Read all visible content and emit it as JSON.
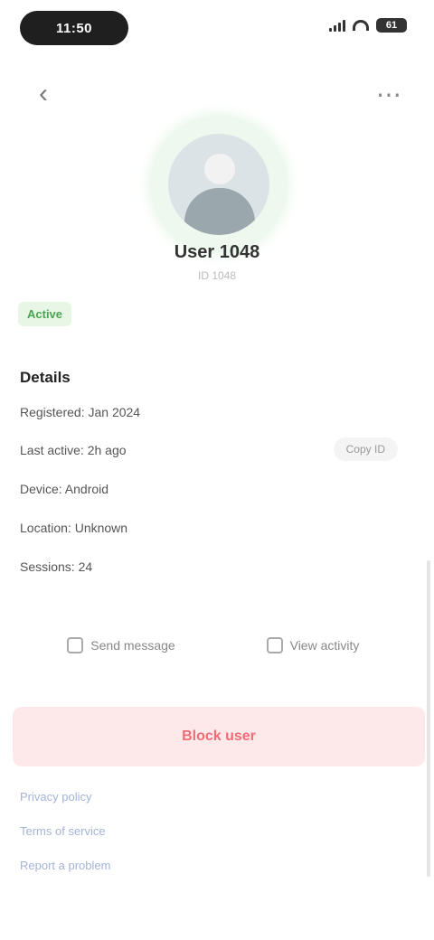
{
  "status": {
    "time": "11:50",
    "battery": "61"
  },
  "nav": {
    "back_icon": "chevron-left-icon",
    "action_icon": "more-icon"
  },
  "profile": {
    "name": "User 1048",
    "subtitle": "ID 1048"
  },
  "chip": "Active",
  "details": {
    "title": "Details",
    "rows": [
      "Registered: Jan 2024",
      "Last active: 2h ago",
      "Device: Android",
      "Location: Unknown",
      "Sessions: 24"
    ],
    "copy_label": "Copy ID"
  },
  "actions": {
    "left": "Send message",
    "right": "View activity"
  },
  "danger": "Block user",
  "footer": [
    "Privacy policy",
    "Terms of service",
    "Report a problem"
  ],
  "colors": {
    "accent": "#4aa453",
    "danger": "#ef6d77",
    "link": "#a4b3d8"
  }
}
